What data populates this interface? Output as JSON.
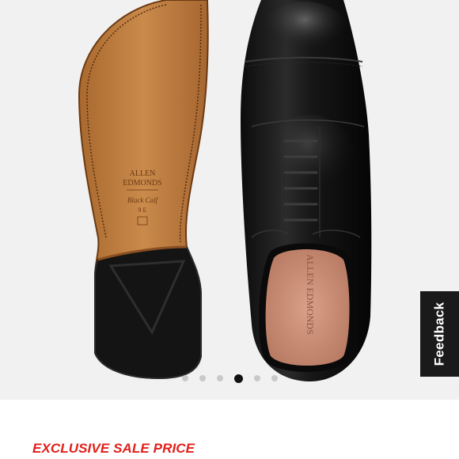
{
  "product": {
    "image_alt": "Black cap-toe oxford shoe shown from top and sole views",
    "sole_stamp": {
      "brand_line_1": "ALLEN",
      "brand_line_2": "EDMONDS",
      "script": "Black Calf",
      "size_mark": "9 E"
    },
    "insole_stamp": "ALLEN EDMONDS"
  },
  "carousel": {
    "dot_count": 6,
    "active_index": 3
  },
  "feedback": {
    "label": "Feedback"
  },
  "sale": {
    "label": "EXCLUSIVE SALE PRICE"
  },
  "colors": {
    "sale_red": "#e0201b",
    "feedback_bg": "#1a1a1a",
    "dot_active": "#111111",
    "dot_inactive": "#c9c9c9",
    "gallery_bg": "#f1f1f1"
  }
}
